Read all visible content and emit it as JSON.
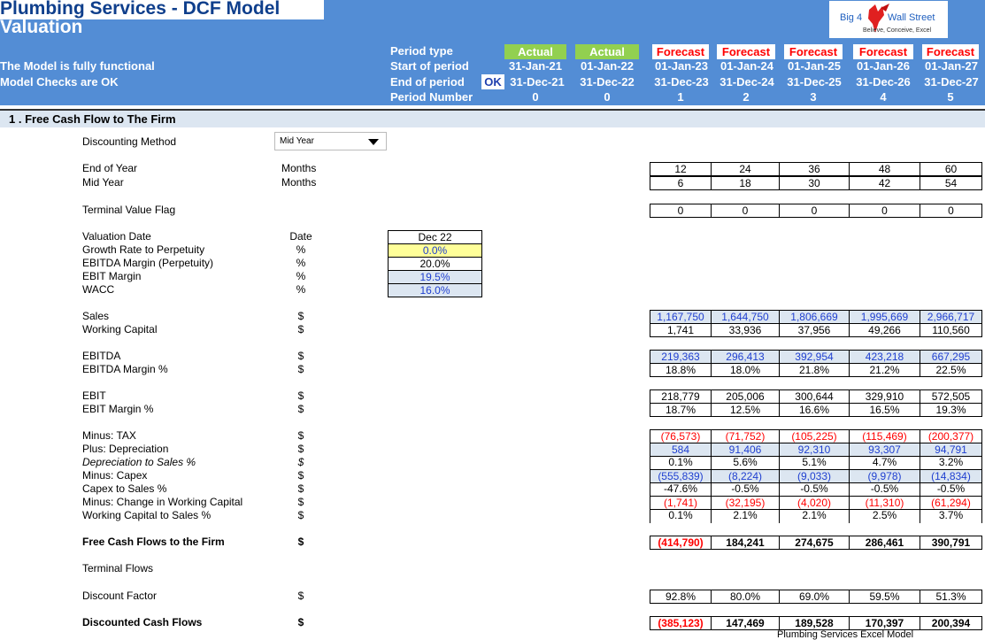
{
  "header": {
    "title": "Plumbing Services - DCF Model",
    "subtitle": "Valuation",
    "status_functional": "The Model is fully functional",
    "status_checks": "Model Checks are OK",
    "ok_flag": "OK",
    "row_labels": {
      "period_type": "Period type",
      "start": "Start of period",
      "end": "End of period",
      "number": "Period Number"
    },
    "periods": [
      {
        "type": "Actual",
        "start": "31-Jan-21",
        "end": "31-Dec-21",
        "number": "0"
      },
      {
        "type": "Actual",
        "start": "01-Jan-22",
        "end": "31-Dec-22",
        "number": "0"
      },
      {
        "type": "Forecast",
        "start": "01-Jan-23",
        "end": "31-Dec-23",
        "number": "1"
      },
      {
        "type": "Forecast",
        "start": "01-Jan-24",
        "end": "31-Dec-24",
        "number": "2"
      },
      {
        "type": "Forecast",
        "start": "01-Jan-25",
        "end": "31-Dec-25",
        "number": "3"
      },
      {
        "type": "Forecast",
        "start": "01-Jan-26",
        "end": "31-Dec-26",
        "number": "4"
      },
      {
        "type": "Forecast",
        "start": "01-Jan-27",
        "end": "31-Dec-27",
        "number": "5"
      }
    ],
    "logo": {
      "left": "Big 4",
      "right": "Wall Street",
      "tagline": "Believe, Conceive, Excel"
    },
    "colors": {
      "header_bg": "#538dd5",
      "actual_bg": "#92d050",
      "forecast_text": "#ff0000",
      "title_text": "#0f3f8c"
    }
  },
  "section": {
    "title": "1 . Free Cash Flow to The Firm"
  },
  "discounting": {
    "label": "Discounting Method",
    "selected": "Mid Year"
  },
  "months": {
    "end_label": "End of Year",
    "mid_label": "Mid Year",
    "unit": "Months",
    "end": [
      "12",
      "24",
      "36",
      "48",
      "60"
    ],
    "mid": [
      "6",
      "18",
      "30",
      "42",
      "54"
    ]
  },
  "terminal_flag": {
    "label": "Terminal Value Flag",
    "values": [
      "0",
      "0",
      "0",
      "0",
      "0"
    ]
  },
  "assumptions": {
    "unit_header": "Date",
    "rows": [
      {
        "label": "Valuation Date",
        "unit": "",
        "value": "Dec 22"
      },
      {
        "label": "Growth Rate to Perpetuity",
        "unit": "%",
        "value": "0.0%"
      },
      {
        "label": "EBITDA Margin (Perpetuity)",
        "unit": "%",
        "value": "20.0%"
      },
      {
        "label": "EBIT Margin",
        "unit": "%",
        "value": "19.5%"
      },
      {
        "label": "WACC",
        "unit": "%",
        "value": "16.0%"
      }
    ]
  },
  "financials": {
    "sales": {
      "label": "Sales",
      "unit": "$",
      "values": [
        "1,167,750",
        "1,644,750",
        "1,806,669",
        "1,995,669",
        "2,966,717"
      ]
    },
    "working_capital": {
      "label": "Working Capital",
      "unit": "$",
      "values": [
        "1,741",
        "33,936",
        "37,956",
        "49,266",
        "110,560"
      ]
    },
    "ebitda": {
      "label": "EBITDA",
      "unit": "$",
      "values": [
        "219,363",
        "296,413",
        "392,954",
        "423,218",
        "667,295"
      ]
    },
    "ebitda_margin": {
      "label": "EBITDA Margin %",
      "unit": "$",
      "values": [
        "18.8%",
        "18.0%",
        "21.8%",
        "21.2%",
        "22.5%"
      ]
    },
    "ebit": {
      "label": "EBIT",
      "unit": "$",
      "values": [
        "218,779",
        "205,006",
        "300,644",
        "329,910",
        "572,505"
      ]
    },
    "ebit_margin": {
      "label": "EBIT Margin %",
      "unit": "$",
      "values": [
        "18.7%",
        "12.5%",
        "16.6%",
        "16.5%",
        "19.3%"
      ]
    },
    "tax": {
      "label": "Minus: TAX",
      "unit": "$",
      "values": [
        "(76,573)",
        "(71,752)",
        "(105,225)",
        "(115,469)",
        "(200,377)"
      ]
    },
    "depreciation": {
      "label": "Plus: Depreciation",
      "unit": "$",
      "values": [
        "584",
        "91,406",
        "92,310",
        "93,307",
        "94,791"
      ]
    },
    "dep_to_sales": {
      "label": "Depreciation to Sales %",
      "unit": "$",
      "values": [
        "0.1%",
        "5.6%",
        "5.1%",
        "4.7%",
        "3.2%"
      ]
    },
    "capex": {
      "label": "Minus: Capex",
      "unit": "$",
      "values": [
        "(555,839)",
        "(8,224)",
        "(9,033)",
        "(9,978)",
        "(14,834)"
      ]
    },
    "capex_to_sales": {
      "label": "Capex to Sales %",
      "unit": "$",
      "values": [
        "-47.6%",
        "-0.5%",
        "-0.5%",
        "-0.5%",
        "-0.5%"
      ]
    },
    "change_wc": {
      "label": "Minus: Change in Working Capital",
      "unit": "$",
      "values": [
        "(1,741)",
        "(32,195)",
        "(4,020)",
        "(11,310)",
        "(61,294)"
      ]
    },
    "wc_to_sales": {
      "label": "Working Capital to Sales %",
      "unit": "$",
      "values": [
        "0.1%",
        "2.1%",
        "2.1%",
        "2.5%",
        "3.7%"
      ]
    },
    "fcff": {
      "label": "Free Cash Flows to the Firm",
      "unit": "$",
      "values": [
        "(414,790)",
        "184,241",
        "274,675",
        "286,461",
        "390,791"
      ]
    },
    "terminal_flows": {
      "label": "Terminal Flows"
    },
    "discount_factor": {
      "label": "Discount Factor",
      "unit": "$",
      "values": [
        "92.8%",
        "80.0%",
        "69.0%",
        "59.5%",
        "51.3%"
      ]
    },
    "discounted_cf": {
      "label": "Discounted Cash Flows",
      "unit": "$",
      "values": [
        "(385,123)",
        "147,469",
        "189,528",
        "170,397",
        "200,394"
      ]
    }
  },
  "footer": {
    "partial_text": "Plumbing Services Excel Model"
  }
}
